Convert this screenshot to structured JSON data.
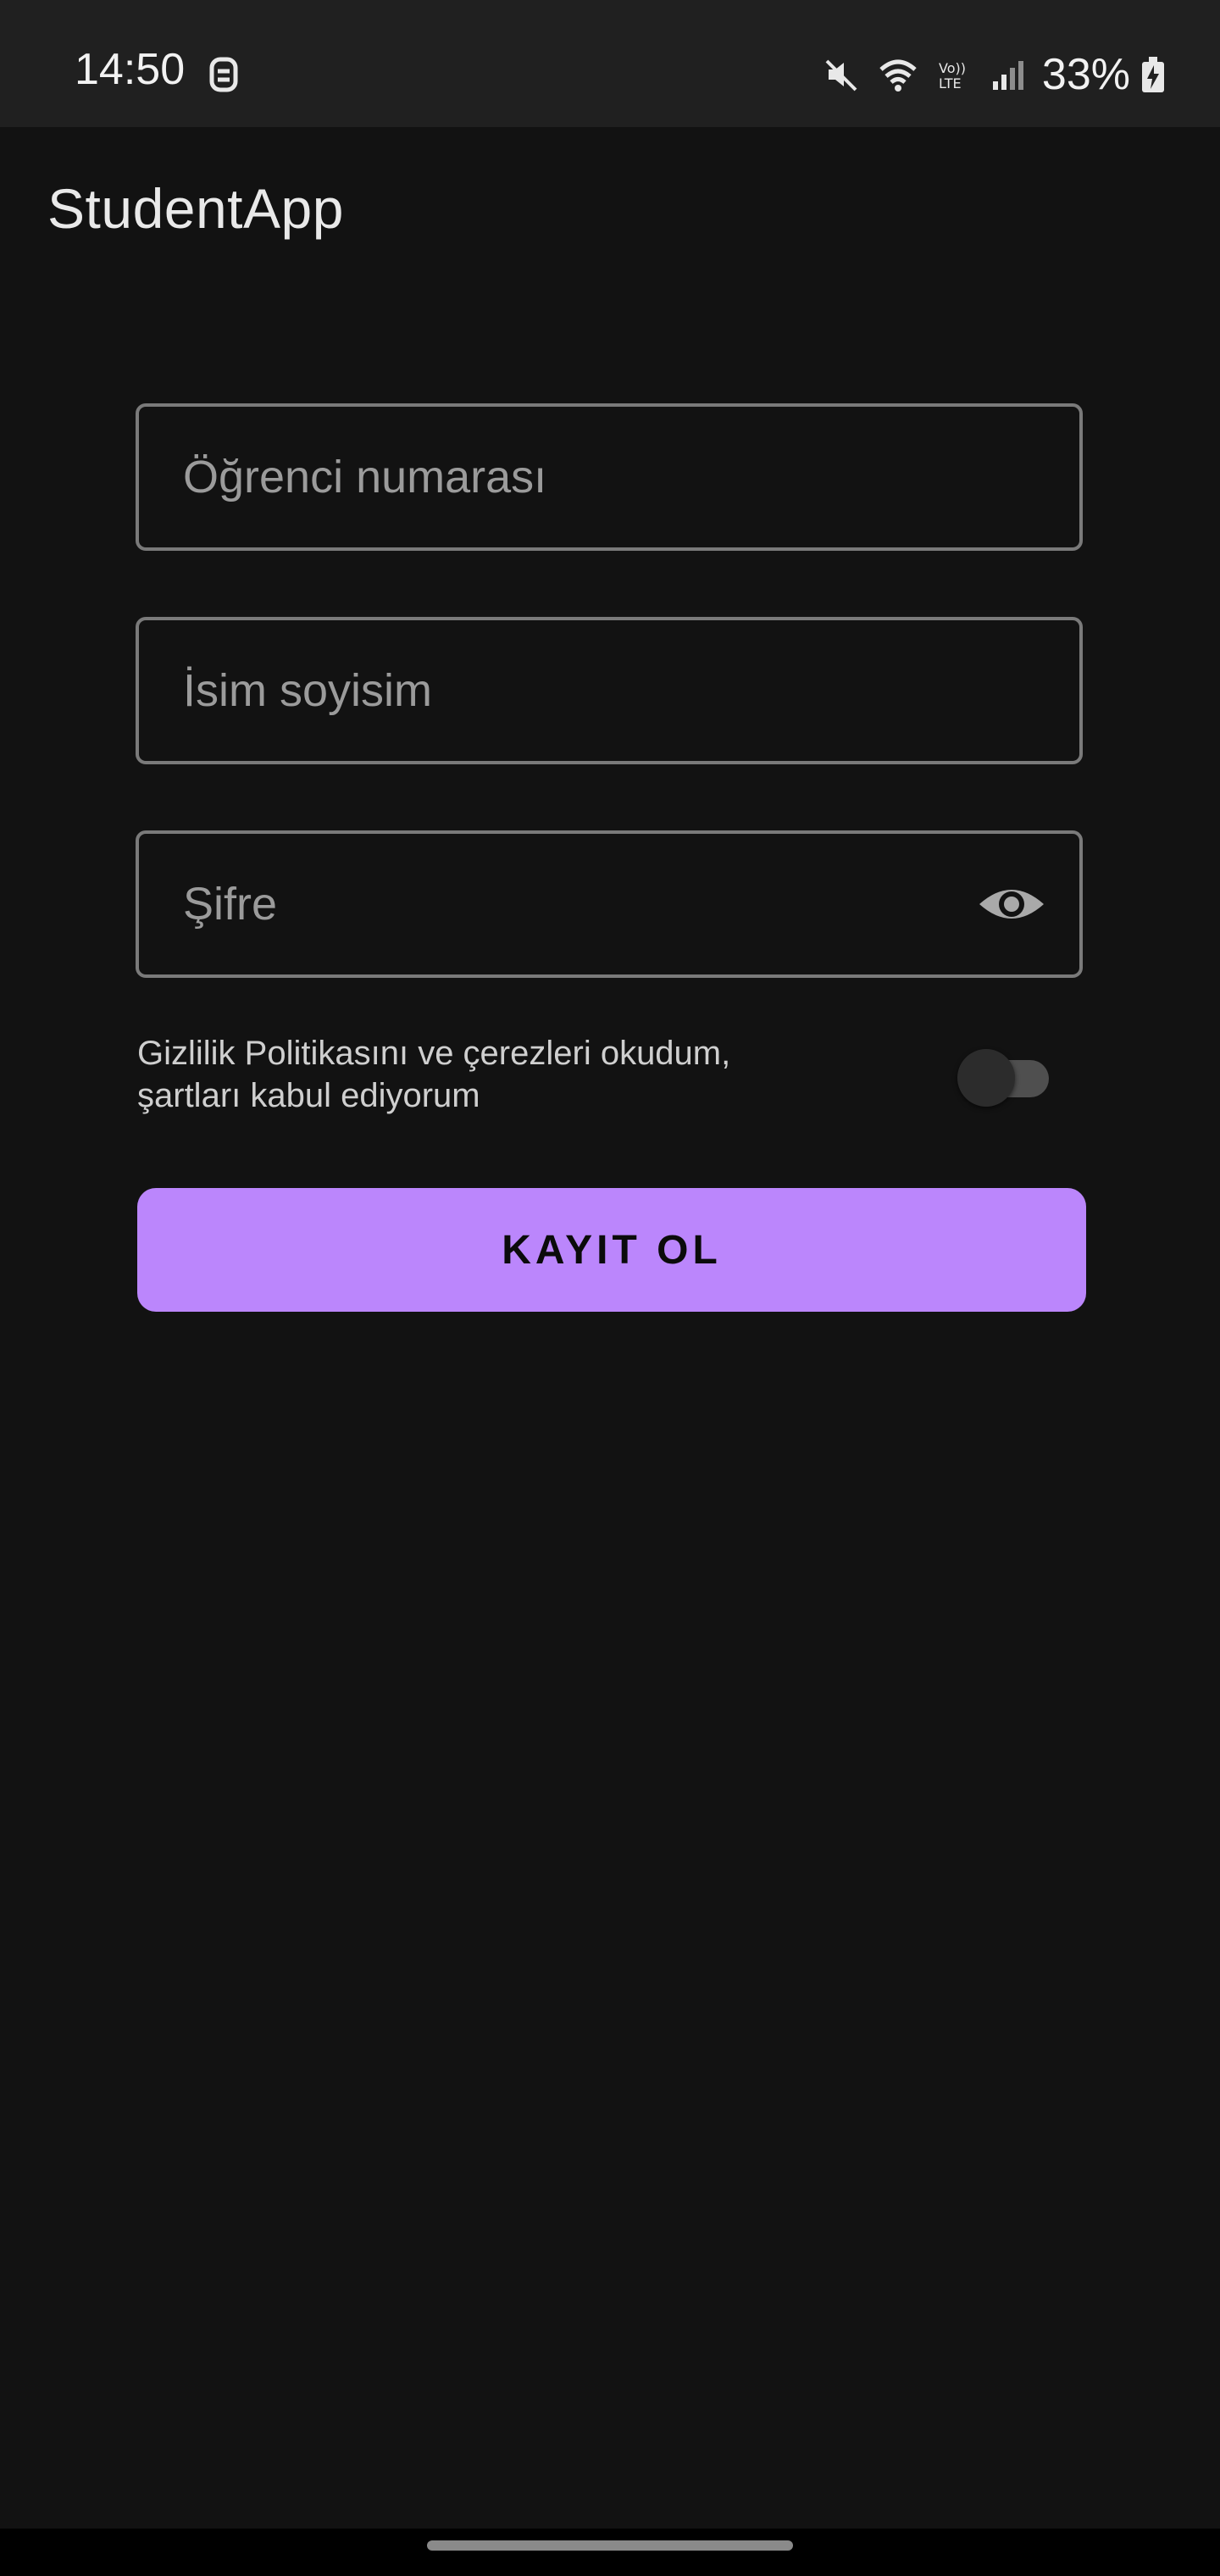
{
  "status_bar": {
    "time": "14:50",
    "left_icon": "notification-icon",
    "icons": [
      "mute-icon",
      "wifi-icon",
      "volte-icon",
      "signal-icon"
    ],
    "battery_percent": "33%",
    "battery_icon": "battery-charging-icon"
  },
  "app_bar": {
    "title": "StudentApp"
  },
  "form": {
    "student_number": {
      "placeholder": "Öğrenci numarası",
      "value": ""
    },
    "full_name": {
      "placeholder": "İsim soyisim",
      "value": ""
    },
    "password": {
      "placeholder": "Şifre",
      "value": "",
      "visibility_icon": "eye-icon"
    },
    "consent": {
      "line1": "Gizlilik Politikasını ve çerezleri okudum,",
      "line2": "şartları kabul ediyorum",
      "checked": false
    },
    "submit_label": "KAYIT OL"
  },
  "colors": {
    "background": "#121212",
    "accent": "#bb86fc"
  }
}
